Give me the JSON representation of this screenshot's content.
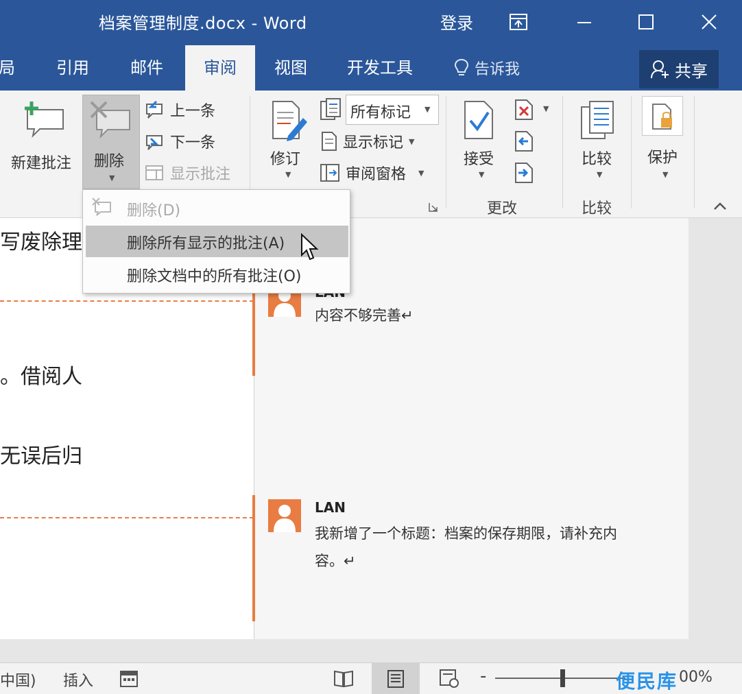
{
  "title_bar": {
    "title": "档案管理制度.docx - Word",
    "login": "登录"
  },
  "tabs": [
    {
      "label": "局",
      "active": false
    },
    {
      "label": "引用",
      "active": false
    },
    {
      "label": "邮件",
      "active": false
    },
    {
      "label": "审阅",
      "active": true
    },
    {
      "label": "视图",
      "active": false
    },
    {
      "label": "开发工具",
      "active": false
    }
  ],
  "tell_me": "告诉我",
  "share": "共享",
  "ribbon": {
    "new_comment": "新建批注",
    "delete": "删除",
    "previous": "上一条",
    "next": "下一条",
    "show_comments": "显示批注",
    "track_changes": "修订",
    "markup_select": "所有标记",
    "show_markup": "显示标记",
    "reviewing_pane": "审阅窗格",
    "accept": "接受",
    "changes_group": "更改",
    "compare": "比较",
    "compare_group": "比较",
    "protect": "保护"
  },
  "delete_menu": {
    "items": [
      {
        "label": "删除(D)",
        "enabled": false
      },
      {
        "label": "删除所有显示的批注(A)",
        "enabled": true,
        "highlighted": true
      },
      {
        "label": "删除文档中的所有批注(O)",
        "enabled": true
      }
    ]
  },
  "document": {
    "lines": [
      "写废除理",
      "。借阅人",
      "无误后归"
    ]
  },
  "comments": [
    {
      "author": "LAN",
      "text": "内容不够完善↵"
    },
    {
      "author": "LAN",
      "text_line1": "我新增了一个标题：档案的保存期限，请补充内",
      "text_line2": "容。↵"
    }
  ],
  "status_bar": {
    "language": "中国)",
    "insert_mode": "插入",
    "zoom_text": "00%",
    "watermark": "便民库"
  },
  "colors": {
    "title_blue": "#2b579a",
    "comment_accent": "#e87c42",
    "watermark": "#2a93e8"
  }
}
